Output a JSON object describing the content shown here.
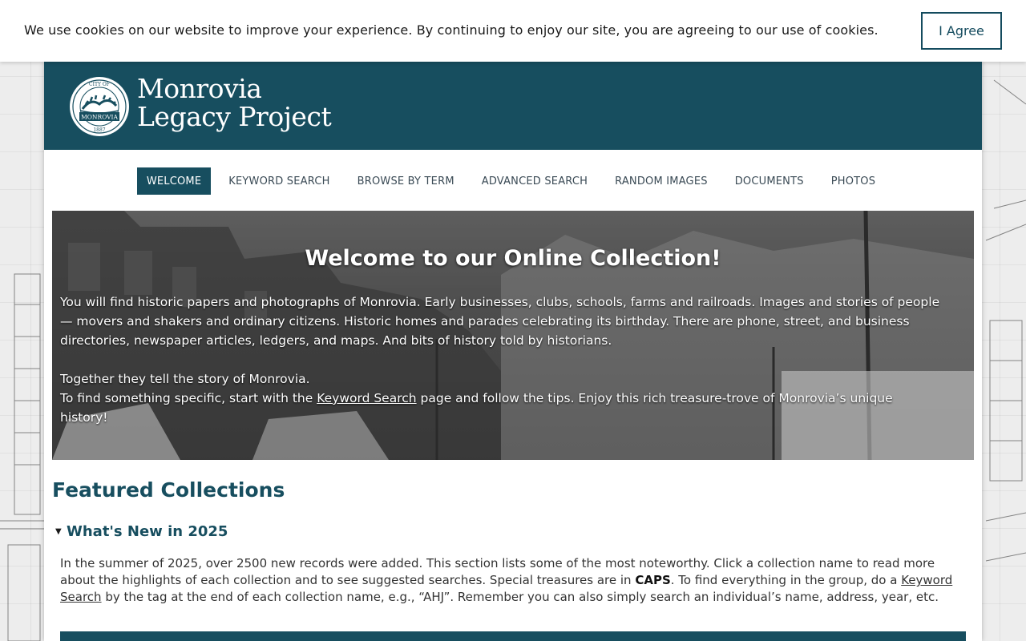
{
  "cookie": {
    "message": "We use cookies on our website to improve your experience. By continuing to enjoy our site, you are agreeing to our use of cookies.",
    "button": "I Agree"
  },
  "header": {
    "brand_line1": "Monrovia",
    "brand_line2": "Legacy Project",
    "seal_top": "CITY OF",
    "seal_middle": "MONROVIA",
    "seal_year": "1887"
  },
  "nav": {
    "items": [
      "WELCOME",
      "KEYWORD SEARCH",
      "BROWSE BY TERM",
      "ADVANCED SEARCH",
      "RANDOM IMAGES",
      "DOCUMENTS",
      "PHOTOS"
    ],
    "active": "WELCOME"
  },
  "hero": {
    "title": "Welcome to our Online Collection!",
    "para1": "You will find historic papers and photographs of Monrovia. Early businesses, clubs, schools, farms and railroads. Images and stories of people — movers and shakers and ordinary citizens. Historic homes and parades celebrating its birthday. There are phone, street, and business directories, newspaper articles, ledgers, and maps. And bits of history told by historians.",
    "para2": "Together they tell the story of Monrovia.",
    "para3_before": "To find something specific, start with the ",
    "para3_link": "Keyword Search",
    "para3_after": " page and follow the tips. Enjoy this rich treasure-trove of Monrovia’s unique history!"
  },
  "featured": {
    "title": "Featured Collections",
    "section_title": "What's New in 2025",
    "body_1": "In the summer of 2025, over 2500 new records were added. This section lists some of the most noteworthy. Click a collection name to read more about the highlights of each collection and to see suggested searches. Special treasures are in ",
    "body_caps": "CAPS",
    "body_2": ". To find everything in the group, do a ",
    "body_link": "Keyword Search",
    "body_3": " by the tag at the end of each collection name, e.g., “AHJ”. Remember you can also simply search an individual’s name, address, year, etc."
  },
  "colors": {
    "brand": "#174e5f",
    "button_border": "#144b5e"
  }
}
